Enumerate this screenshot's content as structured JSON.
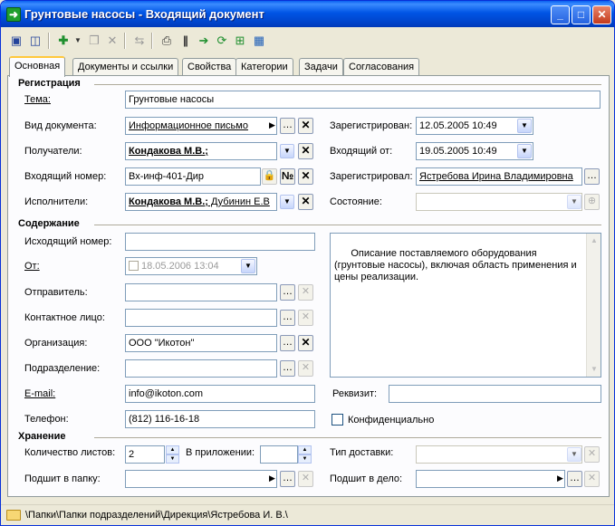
{
  "window": {
    "title": "Грунтовые насосы - Входящий документ"
  },
  "tabs": [
    "Основная",
    "Документы и ссылки",
    "Свойства",
    "Категории",
    "Задачи",
    "Согласования"
  ],
  "registration": {
    "section_title": "Регистрация",
    "subject_label": "Тема:",
    "subject_value": "Грунтовые насосы",
    "doctype_label": "Вид документа:",
    "doctype_value": "Информационное письмо",
    "recipients_label": "Получатели:",
    "recipients_value": "Кондакова М.В.;",
    "incoming_no_label": "Входящий номер:",
    "incoming_no_value": "Вх-инф-401-Дир",
    "numbering_button": "№",
    "executors_label": "Исполнители:",
    "executors_bold": "Кондакова М.В.;",
    "executors_rest": " Дубинин Е.В",
    "registered_label": "Зарегистрирован:",
    "registered_value": "12.05.2005 10:49",
    "incoming_from_label": "Входящий от:",
    "incoming_from_value": "19.05.2005 10:49",
    "registered_by_label": "Зарегистрировал:",
    "registered_by_value": "Ястребова Ирина Владимировна",
    "state_label": "Состояние:",
    "state_value": ""
  },
  "content": {
    "section_title": "Содержание",
    "outgoing_no_label": "Исходящий номер:",
    "outgoing_no_value": "",
    "from_label": "От:",
    "from_value": "18.05.2006 13:04",
    "sender_label": "Отправитель:",
    "sender_value": "",
    "contact_label": "Контактное лицо:",
    "contact_value": "",
    "organization_label": "Организация:",
    "organization_value": "ООО \"Икотон\"",
    "department_label": "Подразделение:",
    "department_value": "",
    "email_label": "E-mail:",
    "email_value": "info@ikoton.com",
    "phone_label": "Телефон:",
    "phone_value": "(812) 116-16-18",
    "description": "Описание поставляемого оборудования (грунтовые насосы), включая область применения и цены реализации.",
    "requisite_label": "Реквизит:",
    "requisite_value": "",
    "confidential_label": "Конфиденциально"
  },
  "storage": {
    "section_title": "Хранение",
    "sheets_label": "Количество листов:",
    "sheets_value": "2",
    "attachment_label": "В приложении:",
    "attachment_value": "",
    "folder_label": "Подшит в папку:",
    "folder_value": "",
    "delivery_label": "Тип доставки:",
    "delivery_value": "",
    "case_label": "Подшит в дело:",
    "case_value": ""
  },
  "statusbar": {
    "path": "\\Папки\\Папки подразделений\\Дирекция\\Ястребова И. В.\\"
  },
  "icons": [
    "save-icon",
    "save-all-icon",
    "new-icon",
    "delete-icon",
    "print-icon",
    "barcode-icon",
    "send-icon",
    "refresh-icon",
    "tree-icon",
    "grid-icon"
  ]
}
